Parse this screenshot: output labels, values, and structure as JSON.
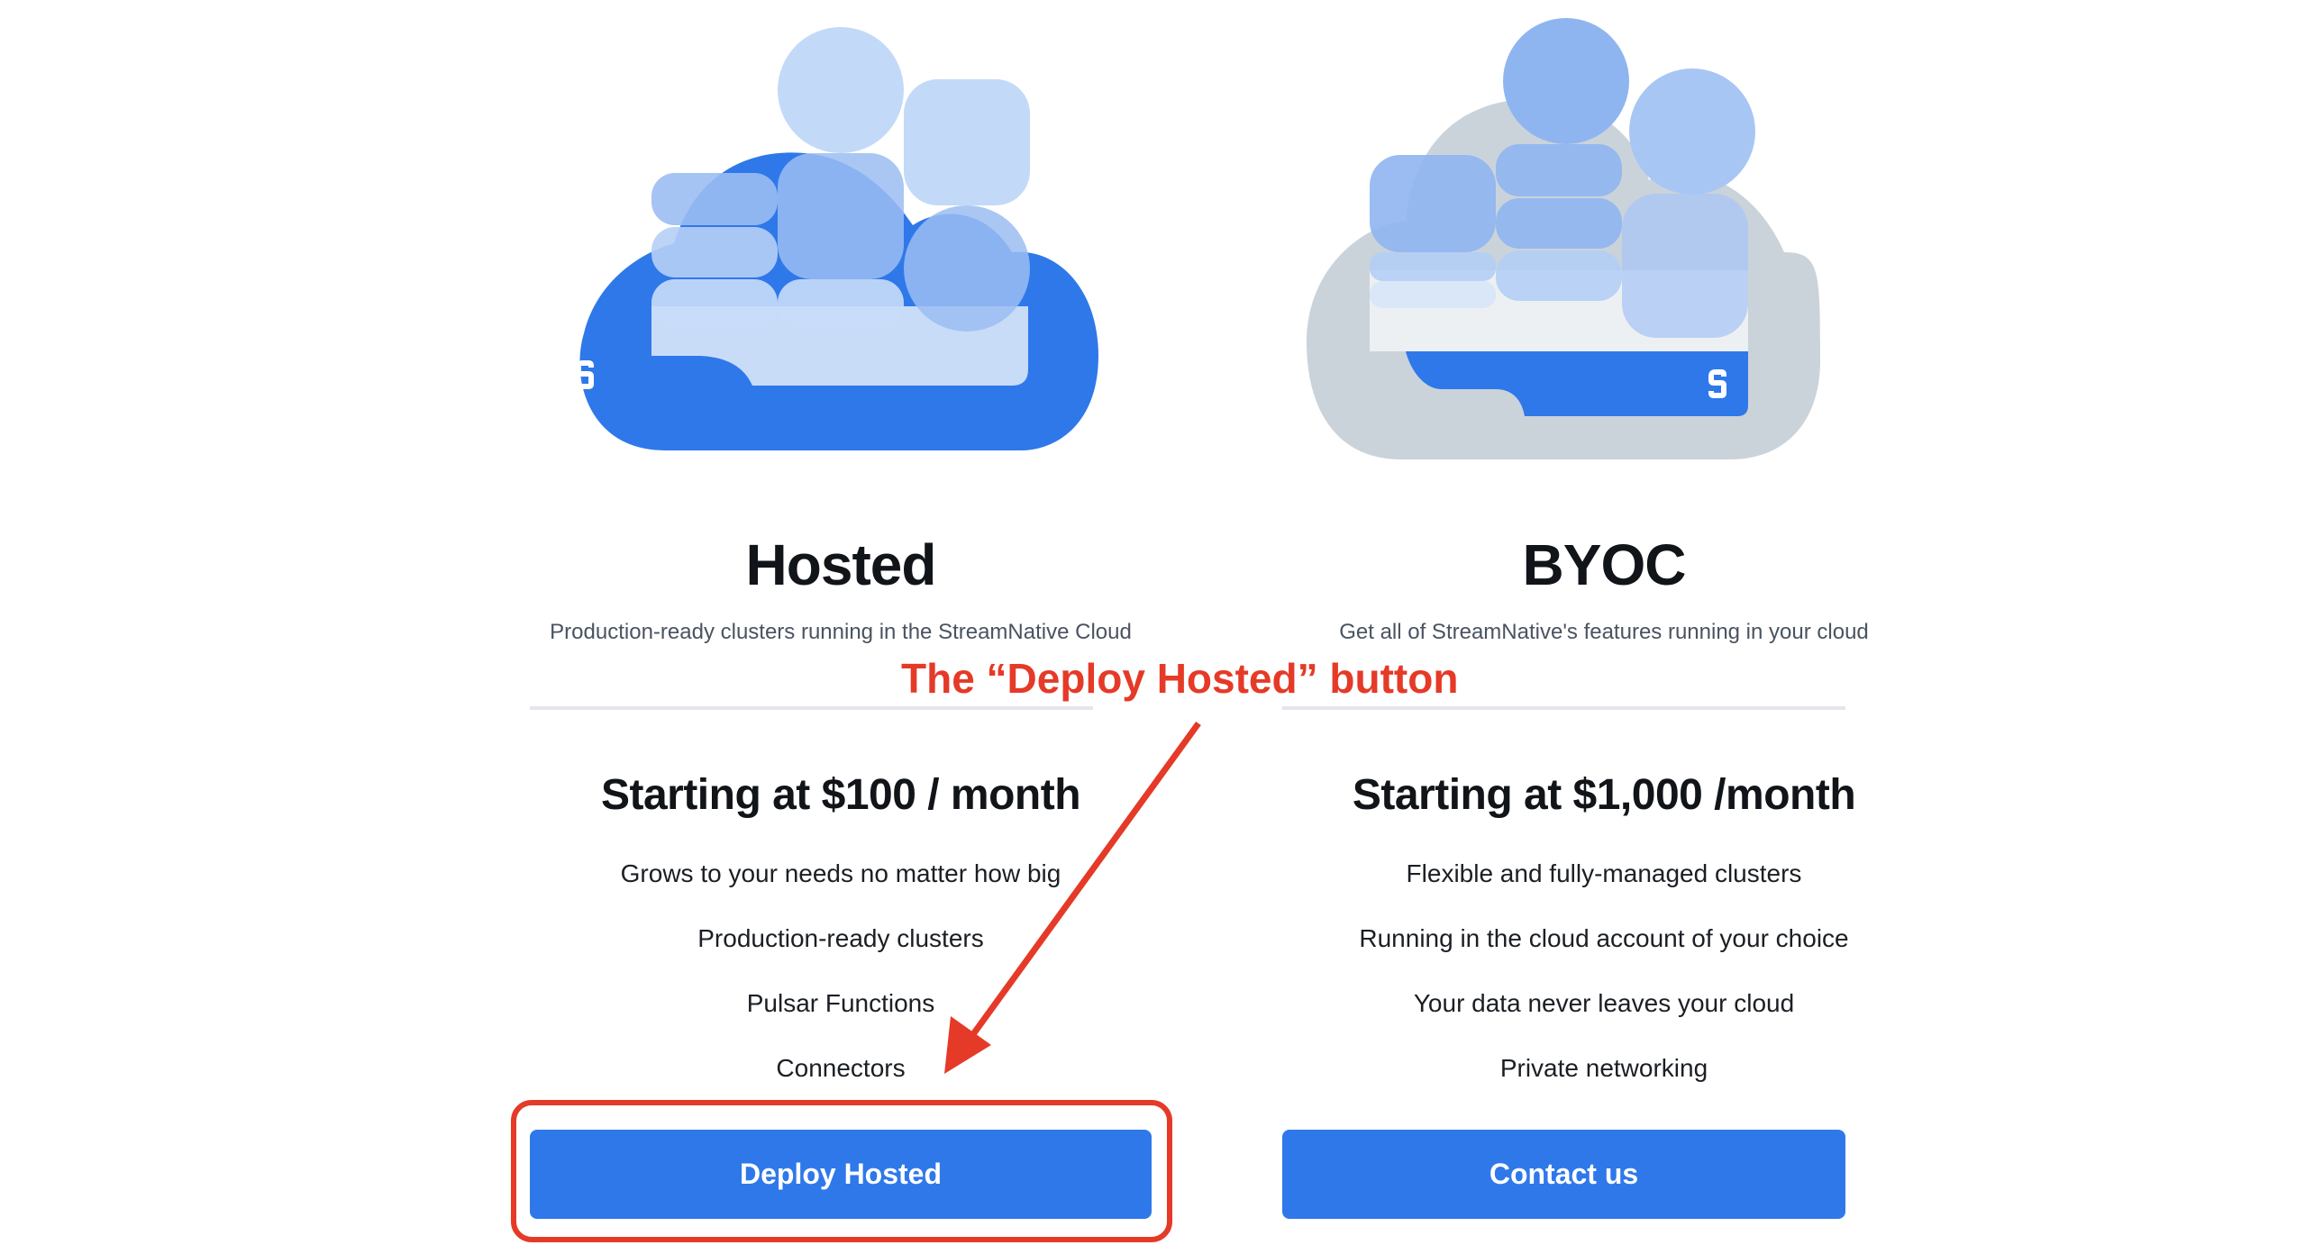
{
  "plans": [
    {
      "title": "Hosted",
      "subtitle": "Production-ready clusters running in the StreamNative Cloud",
      "price": "Starting at $100 / month",
      "features": [
        "Grows to your needs no matter how big",
        "Production-ready clusters",
        "Pulsar Functions",
        "Connectors"
      ],
      "cta_label": "Deploy Hosted"
    },
    {
      "title": "BYOC",
      "subtitle": "Get all of StreamNative's features running in your cloud",
      "price": "Starting at $1,000 /month",
      "features": [
        "Flexible and fully-managed clusters",
        "Running in the cloud account of your choice",
        "Your data never leaves your cloud",
        "Private networking"
      ],
      "cta_label": "Contact us"
    }
  ],
  "annotation": {
    "label": "The “Deploy Hosted” button",
    "color": "#e53a27"
  },
  "colors": {
    "brand_blue": "#2f78ea",
    "cloud_grey": "#cbd3da",
    "light_blue": "#c3d9f8",
    "mid_blue": "#8fb5f1"
  },
  "icons": {
    "hosted_illustration": "blue-cloud-illustration",
    "byoc_illustration": "grey-cloud-illustration",
    "logo": "streamnative-logo-icon"
  }
}
